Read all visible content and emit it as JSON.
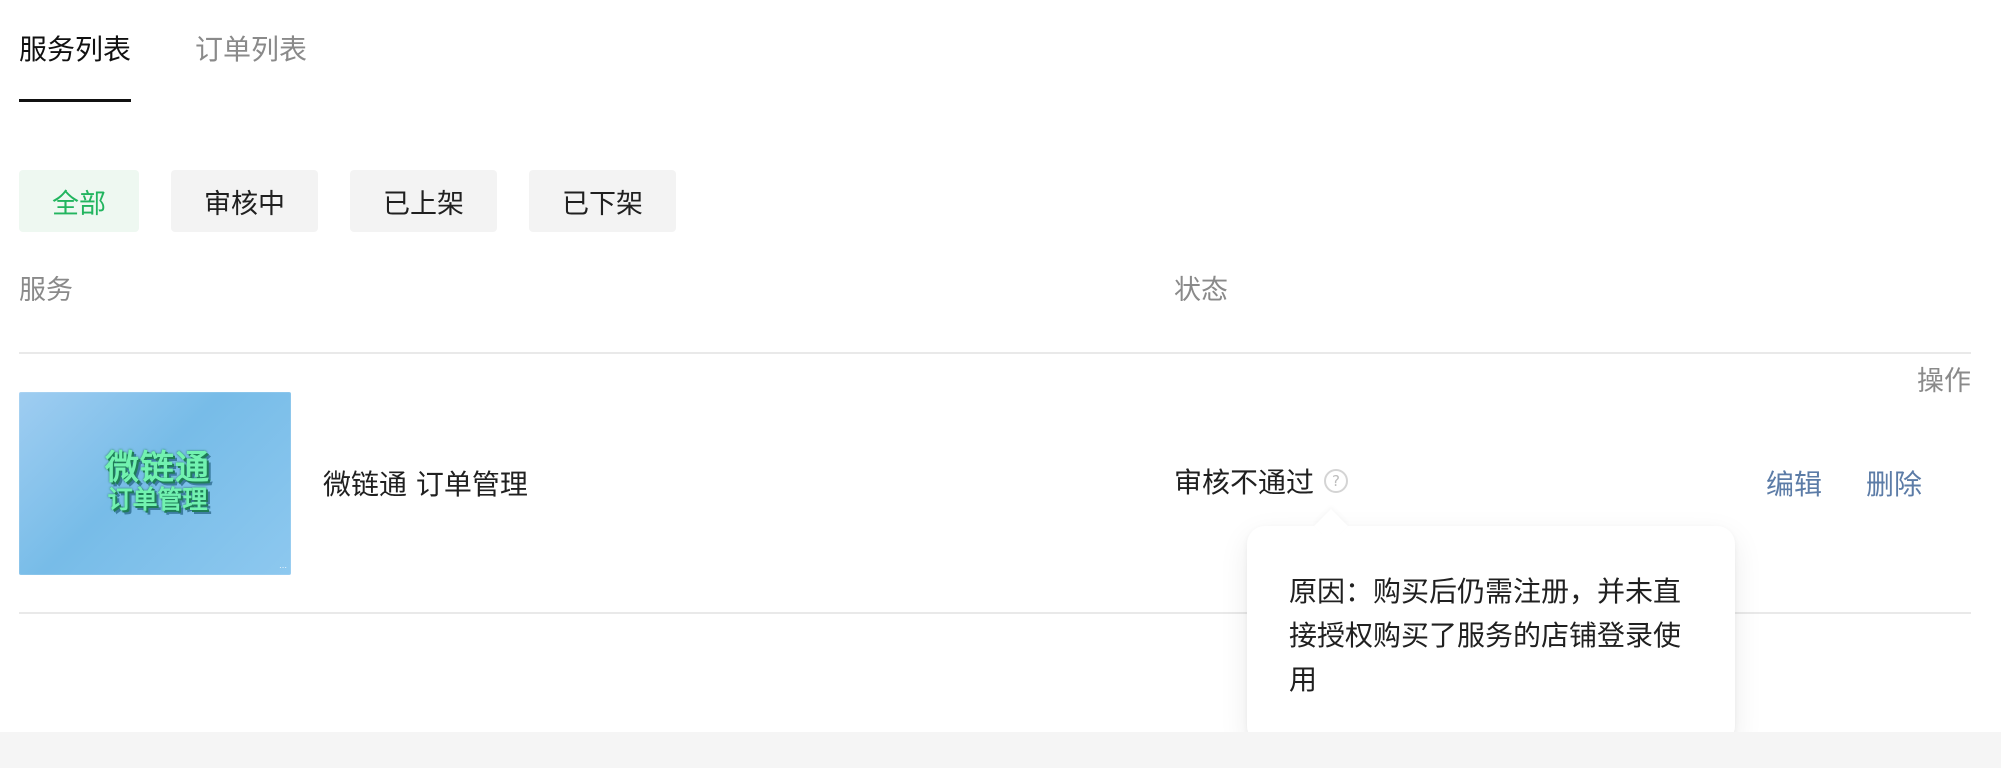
{
  "tabs": [
    {
      "label": "服务列表",
      "active": true
    },
    {
      "label": "订单列表",
      "active": false
    }
  ],
  "filters": [
    {
      "label": "全部",
      "active": true
    },
    {
      "label": "审核中",
      "active": false
    },
    {
      "label": "已上架",
      "active": false
    },
    {
      "label": "已下架",
      "active": false
    }
  ],
  "table": {
    "headers": {
      "service": "服务",
      "status": "状态",
      "actions": "操作"
    },
    "row": {
      "thumbnail": {
        "title": "微链通",
        "subtitle": "订单管理"
      },
      "service_name": "微链通 订单管理",
      "status": "审核不通过",
      "help_icon": "?",
      "actions": {
        "edit": "编辑",
        "delete": "删除"
      }
    }
  },
  "tooltip": {
    "text": "原因：购买后仍需注册，并未直接授权购买了服务的店铺登录使用"
  },
  "colors": {
    "accent_green": "#22b55f",
    "link_blue": "#5c7ca7",
    "muted_gray": "#8a8a8a",
    "divider": "#e9e9e9"
  },
  "icons": {
    "help": "help-icon"
  }
}
